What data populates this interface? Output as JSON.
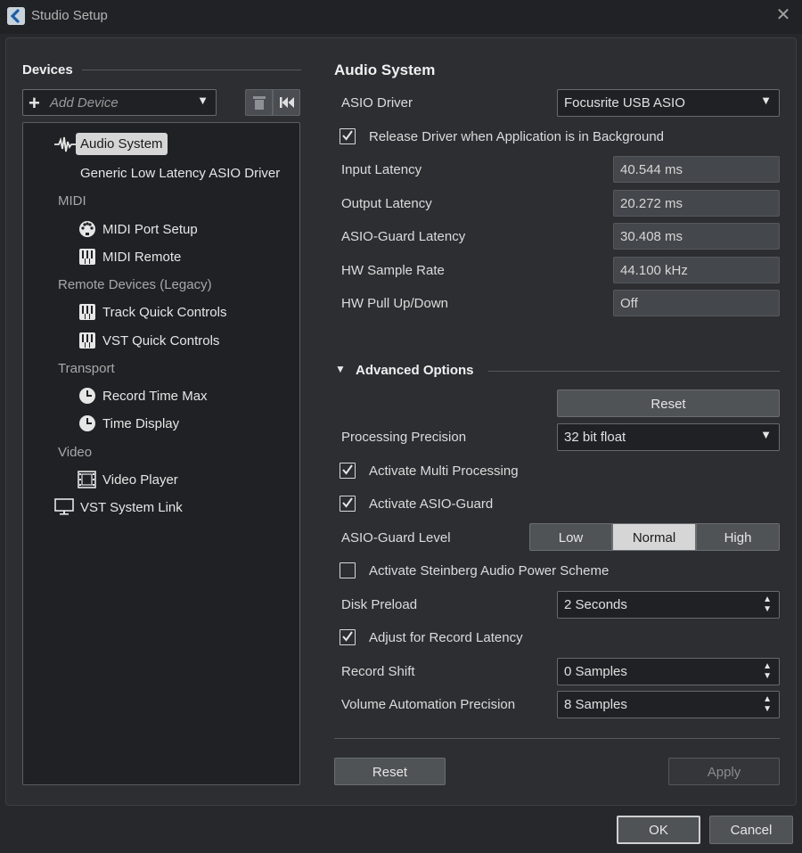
{
  "window": {
    "title": "Studio Setup",
    "close_icon": "close-icon"
  },
  "sidebar": {
    "heading": "Devices",
    "add_device_placeholder": "Add Device",
    "tree": {
      "audio_system": "Audio System",
      "generic_driver": "Generic Low Latency ASIO Driver",
      "midi_category": "MIDI",
      "midi_port_setup": "MIDI Port Setup",
      "midi_remote": "MIDI Remote",
      "remote_category": "Remote Devices (Legacy)",
      "track_quick_controls": "Track Quick Controls",
      "vst_quick_controls": "VST Quick Controls",
      "transport_category": "Transport",
      "record_time_max": "Record Time Max",
      "time_display": "Time Display",
      "video_category": "Video",
      "video_player": "Video Player",
      "vst_system_link": "VST System Link"
    }
  },
  "main": {
    "heading": "Audio System",
    "asio_driver_label": "ASIO Driver",
    "asio_driver_value": "Focusrite USB ASIO",
    "release_driver_label": "Release Driver when Application is in Background",
    "release_driver_checked": true,
    "input_latency_label": "Input Latency",
    "input_latency_value": "40.544 ms",
    "output_latency_label": "Output Latency",
    "output_latency_value": "20.272 ms",
    "asio_guard_latency_label": "ASIO-Guard Latency",
    "asio_guard_latency_value": "30.408 ms",
    "hw_sample_rate_label": "HW Sample Rate",
    "hw_sample_rate_value": "44.100 kHz",
    "hw_pull_label": "HW Pull Up/Down",
    "hw_pull_value": "Off"
  },
  "advanced": {
    "heading": "Advanced Options",
    "reset_label": "Reset",
    "processing_precision_label": "Processing Precision",
    "processing_precision_value": "32 bit float",
    "multi_processing_label": "Activate Multi Processing",
    "multi_processing_checked": true,
    "asio_guard_label": "Activate ASIO-Guard",
    "asio_guard_checked": true,
    "asio_guard_level_label": "ASIO-Guard Level",
    "asio_guard_levels": [
      "Low",
      "Normal",
      "High"
    ],
    "asio_guard_level_selected": "Normal",
    "power_scheme_label": "Activate Steinberg Audio Power Scheme",
    "power_scheme_checked": false,
    "disk_preload_label": "Disk Preload",
    "disk_preload_value": "2 Seconds",
    "record_latency_label": "Adjust for Record Latency",
    "record_latency_checked": true,
    "record_shift_label": "Record Shift",
    "record_shift_value": "0 Samples",
    "volume_precision_label": "Volume Automation Precision",
    "volume_precision_value": "8 Samples"
  },
  "footer": {
    "reset_label": "Reset",
    "apply_label": "Apply",
    "ok_label": "OK",
    "cancel_label": "Cancel"
  },
  "colors": {
    "background": "#2c2e31",
    "field": "#1f2124",
    "readonly_field": "#44474b",
    "selected_segment": "#d6d6d6"
  }
}
